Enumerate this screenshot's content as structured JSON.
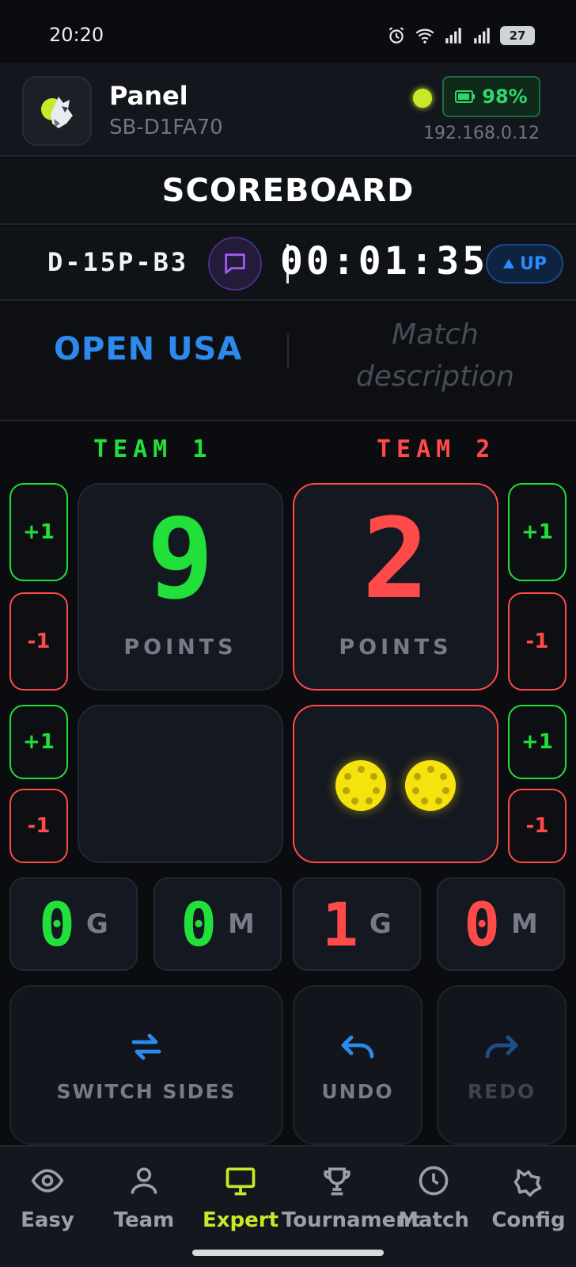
{
  "status_bar": {
    "time": "20:20",
    "battery": "27"
  },
  "header": {
    "title": "Panel",
    "device_id": "SB-D1FA70",
    "battery_percent": "98%",
    "ip": "192.168.0.12",
    "online_color": "#c9e82a"
  },
  "page_title": "SCOREBOARD",
  "info": {
    "code": "D-15P-B3",
    "timer": "00:01:35",
    "direction_label": "UP"
  },
  "match": {
    "tournament": "OPEN USA",
    "description_placeholder": "Match description"
  },
  "teams": [
    {
      "label": "TEAM 1",
      "color": "#22e03a",
      "points": "9",
      "points_label": "POINTS",
      "games": "0",
      "games_unit": "G",
      "matches": "0",
      "matches_unit": "M",
      "serving_balls": 0
    },
    {
      "label": "TEAM 2",
      "color": "#ff4a4a",
      "points": "2",
      "points_label": "POINTS",
      "games": "1",
      "games_unit": "G",
      "matches": "0",
      "matches_unit": "M",
      "serving_balls": 2
    }
  ],
  "controls": {
    "plus": "+1",
    "minus": "-1"
  },
  "actions": {
    "switch_sides": "SWITCH SIDES",
    "undo": "UNDO",
    "redo": "REDO"
  },
  "nav": [
    {
      "label": "Easy",
      "icon": "eye-icon"
    },
    {
      "label": "Team",
      "icon": "user-icon"
    },
    {
      "label": "Expert",
      "icon": "monitor-icon",
      "active": true
    },
    {
      "label": "Tournament",
      "icon": "trophy-icon"
    },
    {
      "label": "Match",
      "icon": "clock-icon"
    },
    {
      "label": "Config",
      "icon": "config-icon"
    }
  ]
}
